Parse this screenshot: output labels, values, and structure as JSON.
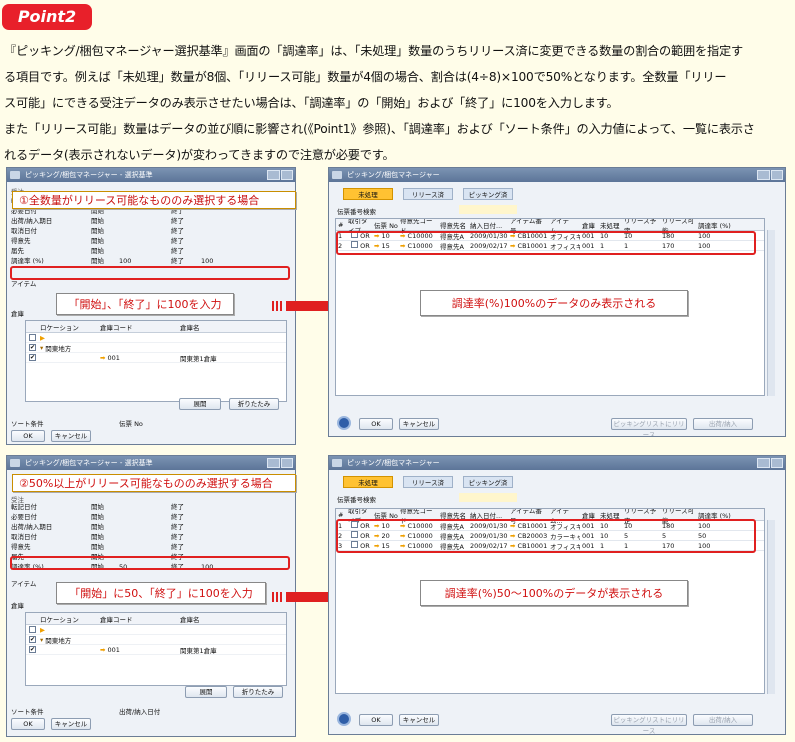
{
  "badge": "Point2",
  "intro": {
    "line1": "『ピッキング/梱包マネージャー選択基準』画面の「調達率」は、「未処理」数量のうちリリース済に変更できる数量の割合の範囲を指定す",
    "line2": "る項目です。例えば「未処理」数量が8個、「リリース可能」数量が4個の場合、割合は(4÷8)×100で50%となります。全数量「リリー",
    "line3": "ス可能」にできる受注データのみ表示させたい場合は、「調達率」の「開始」および「終了」に100を入力します。",
    "line4": "また「リリース可能」数量はデータの並び順に影響され(《Point1》参照)、「調達率」および「ソート条件」の入力値によって、一覧に表示さ",
    "line5": "れるデータ(表示されないデータ)が変わってきますので注意が必要です。"
  },
  "criteria_title": "ピッキング/梱包マネージャー - 選択基準",
  "manager_title": "ピッキング/梱包マネージャー",
  "case1": {
    "heading": "①全数量がリリース可能なもののみ選択する場合",
    "callout": "「開始」、「終了」に100を入力",
    "result": "調達率(%)100%のデータのみ表示される",
    "rate_from": "100",
    "rate_to": "100",
    "sort_value": "伝票 No",
    "rows": [
      {
        "n": "1",
        "type": "OR",
        "doc": "10",
        "cust": "C10000",
        "name": "得意先A",
        "date": "2009/01/30",
        "item": "CB10001",
        "desc": "オフィスキャビ",
        "wh": "001",
        "open": "10",
        "rel": "10",
        "avail": "180",
        "rate": "100"
      },
      {
        "n": "2",
        "type": "OR",
        "doc": "15",
        "cust": "C10000",
        "name": "得意先A",
        "date": "2009/02/17",
        "item": "CB10001",
        "desc": "オフィスキャビ",
        "wh": "001",
        "open": "1",
        "rel": "1",
        "avail": "170",
        "rate": "100"
      }
    ]
  },
  "case2": {
    "heading": "②50%以上がリリース可能なもののみ選択する場合",
    "callout": "「開始」に50、「終了」に100を入力",
    "result": "調達率(%)50～100%のデータが表示される",
    "rate_from": "50",
    "rate_to": "100",
    "sort_value": "出荷/納入日付",
    "rows": [
      {
        "n": "1",
        "type": "OR",
        "doc": "10",
        "cust": "C10000",
        "name": "得意先A",
        "date": "2009/01/30",
        "item": "CB10001",
        "desc": "オフィスキャビ",
        "wh": "001",
        "open": "10",
        "rel": "10",
        "avail": "180",
        "rate": "100"
      },
      {
        "n": "2",
        "type": "OR",
        "doc": "20",
        "cust": "C10000",
        "name": "得意先A",
        "date": "2009/01/30",
        "item": "CB20003",
        "desc": "カラーキャビ",
        "wh": "001",
        "open": "10",
        "rel": "5",
        "avail": "5",
        "rate": "50"
      },
      {
        "n": "3",
        "type": "OR",
        "doc": "15",
        "cust": "C10000",
        "name": "得意先A",
        "date": "2009/02/17",
        "item": "CB10001",
        "desc": "オフィスキャビ",
        "wh": "001",
        "open": "1",
        "rel": "1",
        "avail": "170",
        "rate": "100"
      }
    ]
  },
  "criteria": {
    "fields": [
      "転記日付",
      "必要日付",
      "出荷/納入期日",
      "取消日付",
      "得意先",
      "届先",
      "調達率 (%)"
    ],
    "truncated_field": "受注",
    "start_label": "開始",
    "end_label": "終了",
    "item_label": "アイテム",
    "warehouse_label": "倉庫",
    "tree_headers": [
      "ロケーション",
      "倉庫コード",
      "倉庫名"
    ],
    "tree_region": "関東地方",
    "tree_code": "001",
    "tree_name": "関東第1倉庫",
    "expand": "展開",
    "collapse": "折りたたみ",
    "sort_label": "ソート条件",
    "ok": "OK",
    "cancel": "キャンセル"
  },
  "manager": {
    "tabs": [
      "未処理",
      "リリース済",
      "ピッキング済"
    ],
    "field_label": "伝票番号検索",
    "headers": [
      "#",
      "取引タイプ",
      "伝票 No",
      "得意先コード",
      "得意先名",
      "納入日付...",
      "アイテム番号",
      "アイテム...",
      "倉庫",
      "未処理",
      "リリース予定",
      "リリース可能",
      "調達率 (%)"
    ],
    "ok": "OK",
    "cancel": "キャンセル",
    "btn_picklist": "ピッキングリストにリリース",
    "btn_ship": "出荷/納入"
  },
  "colors": {
    "accent_red": "#e02020",
    "tab_active": "#ffc232",
    "title_bar": "#5c7598",
    "page_bg": "#fffde9"
  }
}
